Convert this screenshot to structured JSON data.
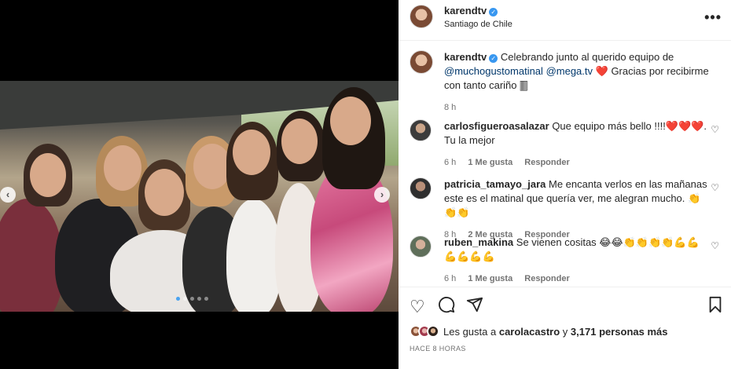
{
  "post": {
    "username": "karendtv",
    "location": "Santiago de Chile",
    "caption": "Celebrando junto al querido equipo de",
    "mention1": "@muchogustomatinal",
    "mention2": "@mega.tv",
    "heart": "❤️",
    "caption_end": " Gracias por recibirme con tanto cariño 🀫",
    "time": "8 h"
  },
  "media": {
    "prev": "‹",
    "next": "›",
    "slides_total": 5,
    "slide_active": 1
  },
  "comments": [
    {
      "username": "carlosfigueroasalazar",
      "text": "Que equipo más bello !!!!❤️❤️❤️. Tu la mejor",
      "time": "6 h",
      "likes": "1 Me gusta",
      "reply": "Responder"
    },
    {
      "username": "patricia_tamayo_jara",
      "text": "Me encanta verlos en las mañanas este es el matinal que quería ver, me alegran mucho. 👏👏👏",
      "time": "8 h",
      "likes": "2 Me gusta",
      "reply": "Responder"
    },
    {
      "username": "ruben_makina",
      "text": "Se vienen cositas 😂😂👏👏👏👏💪💪💪💪💪💪",
      "time": "6 h",
      "likes": "1 Me gusta",
      "reply": "Responder"
    }
  ],
  "footer": {
    "likes_prefix": "Les gusta a",
    "liked_by": "carolacastro",
    "likes_and": "y",
    "likes_count": "3,171 personas más",
    "posted": "HACE 8 HORAS"
  },
  "icons": {
    "more": "more-options-icon",
    "like": "heart-icon",
    "comment": "comment-icon",
    "share": "share-icon",
    "save": "bookmark-icon",
    "verified": "verified-badge-icon"
  },
  "colors": {
    "verified": "#3897f0",
    "link": "#00376b",
    "muted": "#737373"
  }
}
